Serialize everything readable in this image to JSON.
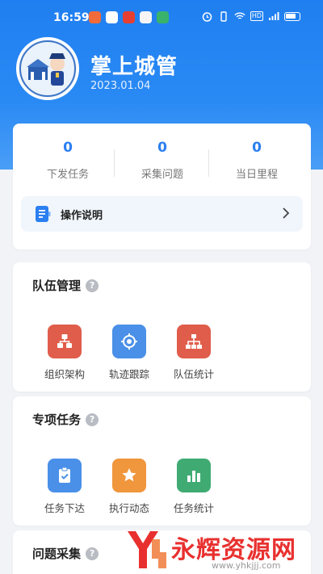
{
  "status_bar": {
    "time": "16:59",
    "signal_badge": "HD"
  },
  "header": {
    "title": "掌上城管",
    "date": "2023.01.04"
  },
  "stats": [
    {
      "value": "0",
      "label": "下发任务"
    },
    {
      "value": "0",
      "label": "采集问题"
    },
    {
      "value": "0",
      "label": "当日里程"
    }
  ],
  "manual": {
    "label": "操作说明"
  },
  "sections": {
    "team": {
      "title": "队伍管理",
      "items": [
        {
          "label": "组织架构",
          "icon": "org-structure-icon",
          "color": "#e05d4b"
        },
        {
          "label": "轨迹跟踪",
          "icon": "track-icon",
          "color": "#4a90e8"
        },
        {
          "label": "队伍统计",
          "icon": "team-stats-icon",
          "color": "#e05d4b"
        }
      ]
    },
    "special": {
      "title": "专项任务",
      "items": [
        {
          "label": "任务下达",
          "icon": "task-assign-icon",
          "color": "#4a90e8"
        },
        {
          "label": "执行动态",
          "icon": "execution-icon",
          "color": "#f0963c"
        },
        {
          "label": "任务统计",
          "icon": "task-stats-icon",
          "color": "#3fab73"
        }
      ]
    },
    "problem": {
      "title": "问题采集"
    }
  },
  "help_mark": "?",
  "watermark": {
    "text": "永辉资源网",
    "url": "www.yhkjjj.com"
  },
  "colors": {
    "primary": "#2b7ff0",
    "header_bg": "#1f7ff0"
  }
}
